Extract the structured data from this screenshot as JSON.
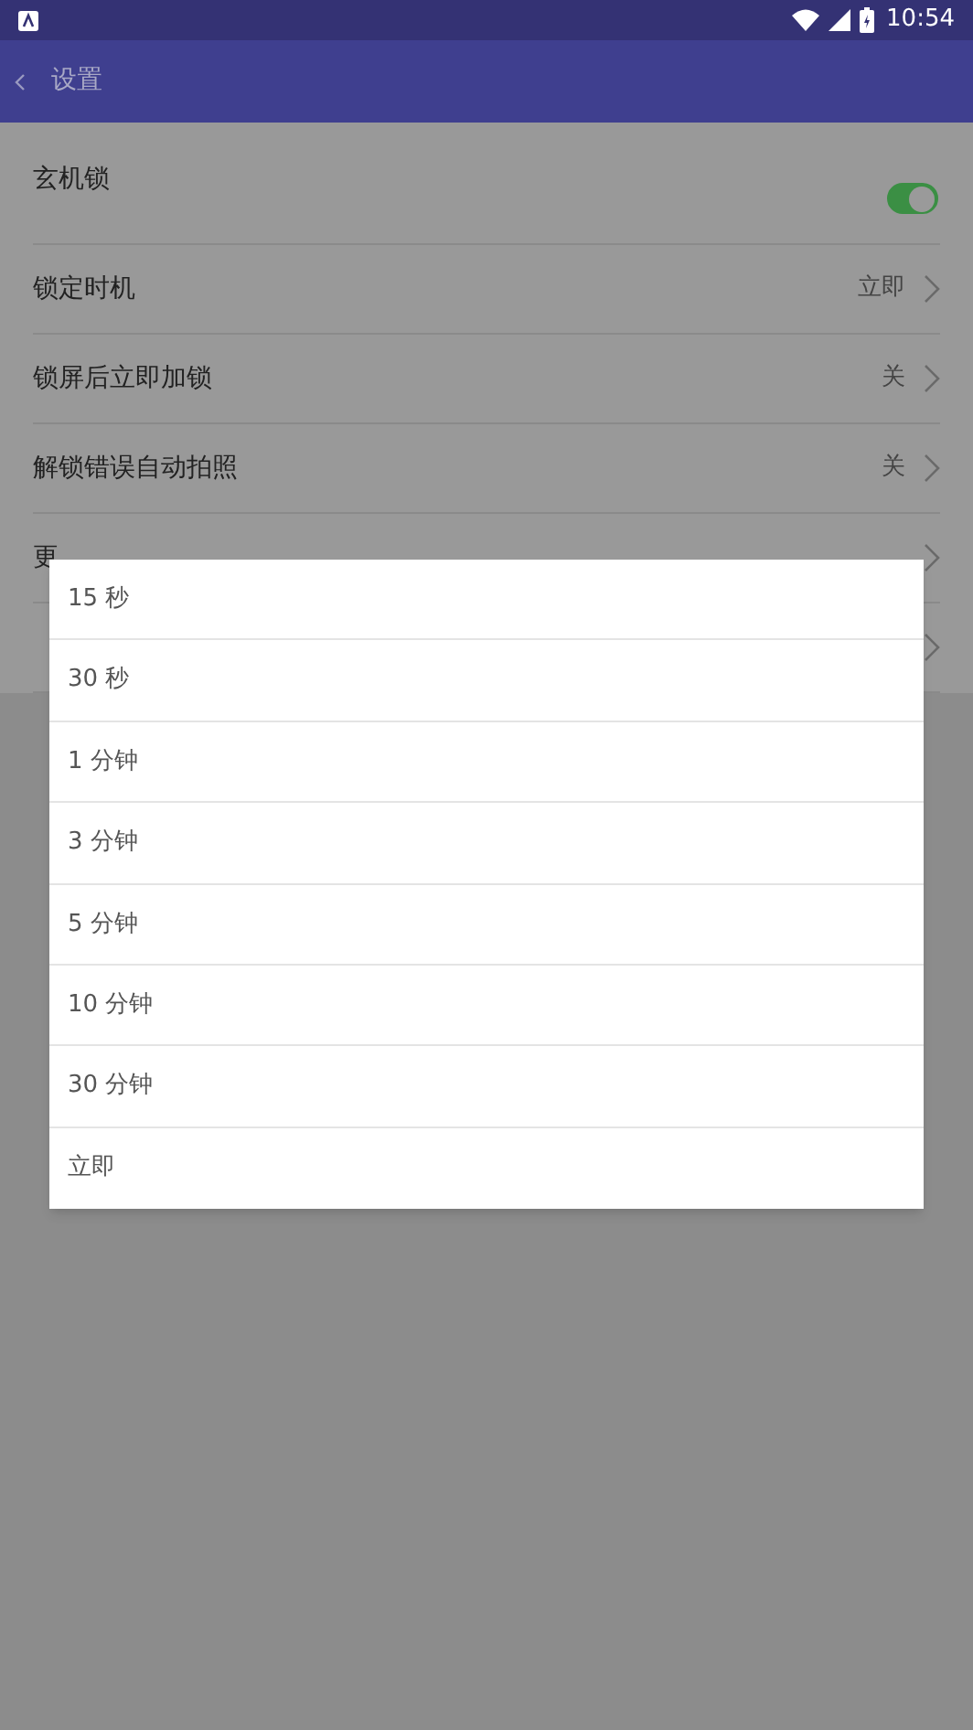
{
  "status_bar": {
    "time": "10:54"
  },
  "app_bar": {
    "title": "设置"
  },
  "settings": [
    {
      "kind": "toggle",
      "label": "玄机锁",
      "on": true
    },
    {
      "kind": "value",
      "label": "锁定时机",
      "value": "立即"
    },
    {
      "kind": "value",
      "label": "锁屏后立即加锁",
      "value": "关"
    },
    {
      "kind": "value",
      "label": "解锁错误自动拍照",
      "value": "关"
    },
    {
      "kind": "link",
      "label": "更"
    },
    {
      "kind": "link"
    }
  ],
  "menu": {
    "options": [
      "15 秒",
      "30 秒",
      "1 分钟",
      "3 分钟",
      "5 分钟",
      "10 分钟",
      "30 分钟",
      "立即"
    ]
  }
}
